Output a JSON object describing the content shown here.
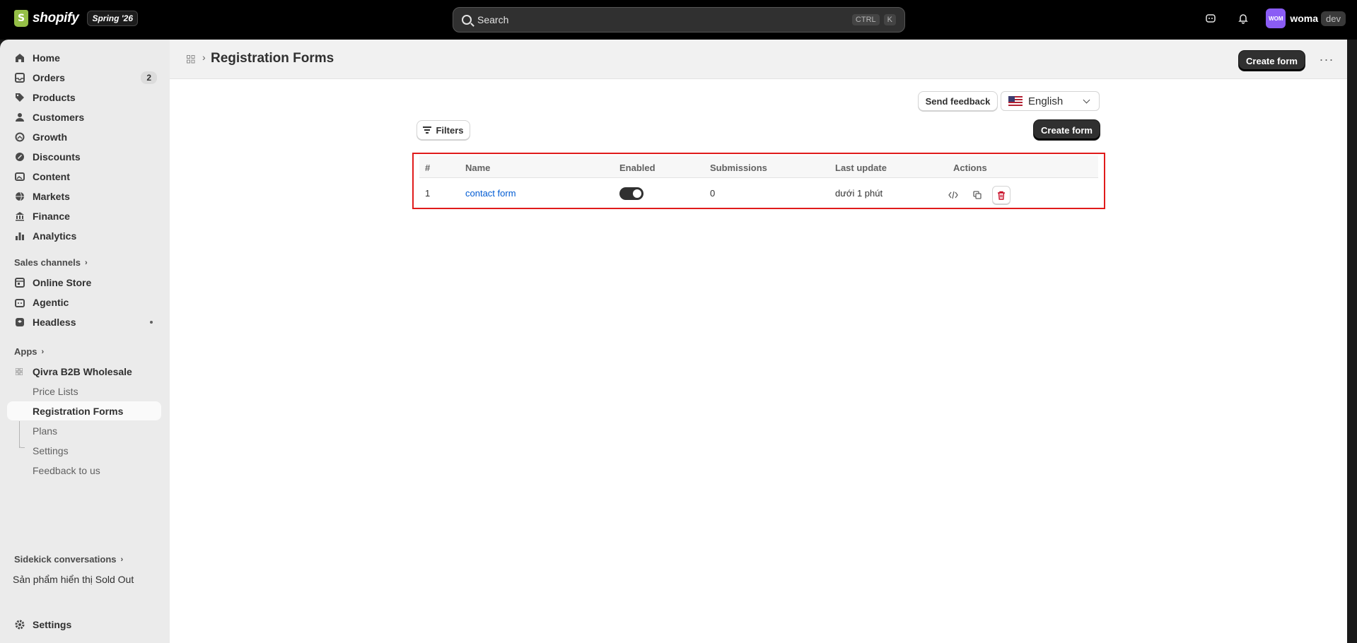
{
  "topbar": {
    "logo_text": "shopify",
    "version": "Spring '26",
    "search_placeholder": "Search",
    "shortcut_ctrl": "CTRL",
    "shortcut_key": "K",
    "avatar_initials": "WOM",
    "store_name": "woma",
    "env_badge": "dev"
  },
  "sidebar": {
    "items": [
      {
        "label": "Home",
        "icon": "home-icon"
      },
      {
        "label": "Orders",
        "icon": "inbox-icon",
        "badge": "2"
      },
      {
        "label": "Products",
        "icon": "tag-icon"
      },
      {
        "label": "Customers",
        "icon": "person-icon"
      },
      {
        "label": "Growth",
        "icon": "growth-icon"
      },
      {
        "label": "Discounts",
        "icon": "discount-icon"
      },
      {
        "label": "Content",
        "icon": "image-icon"
      },
      {
        "label": "Markets",
        "icon": "globe-icon"
      },
      {
        "label": "Finance",
        "icon": "bank-icon"
      },
      {
        "label": "Analytics",
        "icon": "bar-chart-icon"
      }
    ],
    "sales_channels_label": "Sales channels",
    "channels": [
      {
        "label": "Online Store",
        "icon": "store-icon"
      },
      {
        "label": "Agentic",
        "icon": "robot-icon"
      },
      {
        "label": "Headless",
        "icon": "layers-icon"
      }
    ],
    "apps_label": "Apps",
    "app_name": "Qivra B2B Wholesale",
    "app_pages": [
      "Price Lists",
      "Registration Forms",
      "Plans",
      "Settings",
      "Feedback to us"
    ],
    "sidekick_label": "Sidekick conversations",
    "sidekick_item": "Sản phẩm hiển thị Sold Out",
    "settings_label": "Settings"
  },
  "header": {
    "title": "Registration Forms",
    "create_label": "Create form",
    "more_label": "···"
  },
  "toolbar": {
    "feedback_label": "Send feedback",
    "language": "English",
    "filters_label": "Filters",
    "create_label": "Create form"
  },
  "table": {
    "columns": [
      "#",
      "Name",
      "Enabled",
      "Submissions",
      "Last update",
      "Actions"
    ],
    "rows": [
      {
        "index": "1",
        "name": "contact form",
        "enabled": true,
        "submissions": "0",
        "last_update": "dưới 1 phút"
      }
    ]
  },
  "colors": {
    "accent": "#303030",
    "link": "#005bd3",
    "highlight": "#e01b1b",
    "danger": "#c70a24",
    "avatar": "#8a5cf5"
  }
}
